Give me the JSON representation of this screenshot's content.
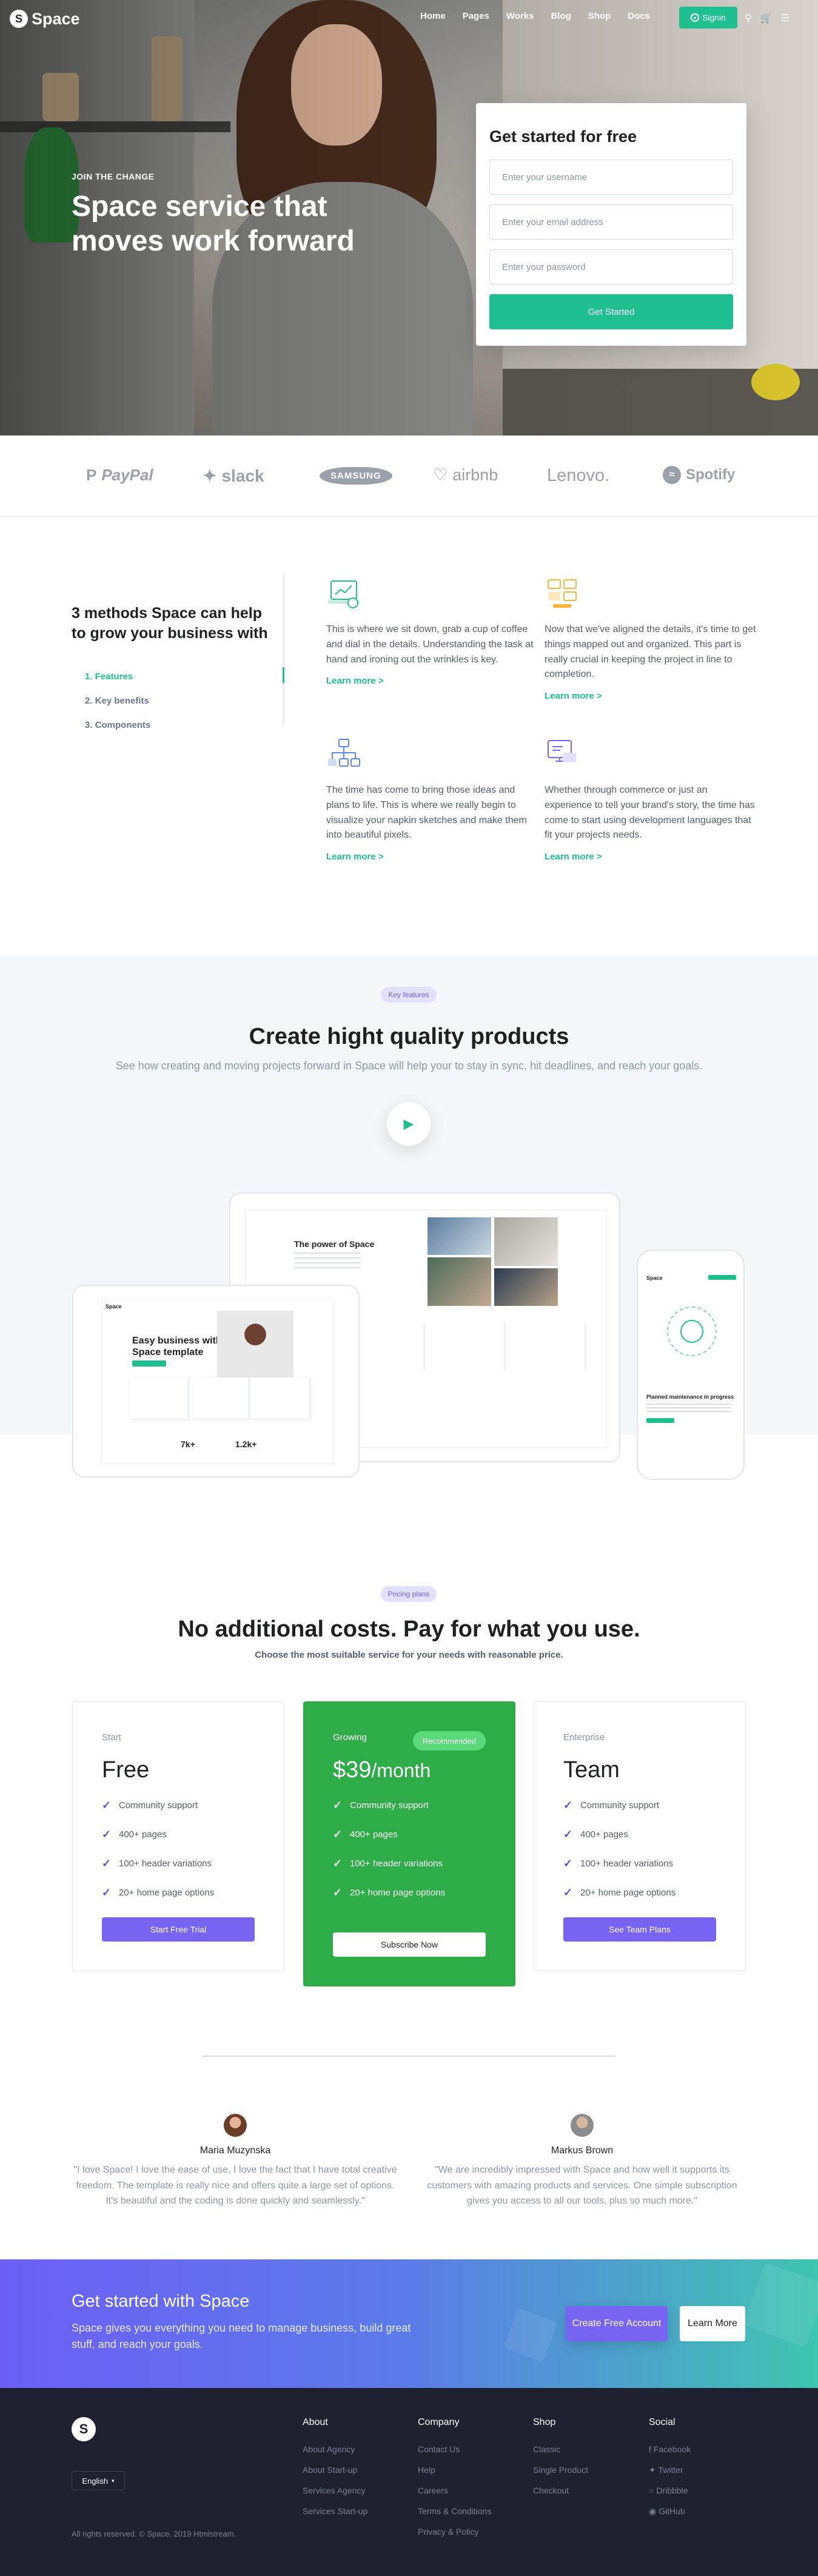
{
  "nav": {
    "brand": "Space",
    "brand_mark": "S",
    "items": [
      "Home",
      "Pages",
      "Works",
      "Blog",
      "Shop",
      "Docs"
    ],
    "signin": "Signin",
    "icons": [
      "search-icon",
      "cart-icon",
      "menu-icon"
    ]
  },
  "hero": {
    "eyebrow": "JOIN THE CHANGE",
    "title_line1": "Space service that",
    "title_line2": "moves work forward"
  },
  "signup": {
    "title": "Get started for free",
    "username_placeholder": "Enter your username",
    "email_placeholder": "Enter your email address",
    "password_placeholder": "Enter your password",
    "button": "Get Started"
  },
  "clients": [
    "PayPal",
    "slack",
    "SAMSUNG",
    "airbnb",
    "Lenovo.",
    "Spotify"
  ],
  "features": {
    "heading": "3 methods Space can help to grow your business with",
    "list": [
      "1. Features",
      "2. Key benefits",
      "3. Components"
    ],
    "cards": [
      {
        "icon": "laptop-chart-icon",
        "text": "This is where we sit down, grab a cup of coffee and dial in the details. Understanding the task at hand and ironing out the wrinkles is key.",
        "link": "Learn more >"
      },
      {
        "icon": "ui-blocks-icon",
        "text": "Now that we've aligned the details, it's time to get things mapped out and organized. This part is really crucial in keeping the project in line to completion.",
        "link": "Learn more >"
      },
      {
        "icon": "sitemap-icon",
        "text": "The time has come to bring those ideas and plans to life. This is where we really begin to visualize your napkin sketches and make them into beautiful pixels.",
        "link": "Learn more >"
      },
      {
        "icon": "monitor-chat-icon",
        "text": "Whether through commerce or just an experience to tell your brand's story, the time has come to start using development languages that fit your projects needs.",
        "link": "Learn more >"
      }
    ]
  },
  "key_features": {
    "pill": "Key features",
    "title": "Create hight quality products",
    "subtitle": "See how creating and moving projects forward in Space will help your to stay in sync, hit deadlines, and reach your goals.",
    "mockup": {
      "desktop_title": "The power of Space",
      "tablet_brand": "Space",
      "tablet_heading_1": "Easy business with",
      "tablet_heading_2": "Space template",
      "tablet_stat_1": "7k+",
      "tablet_stat_2": "1.2k+",
      "phone_brand": "Space",
      "phone_caption": "Planned maintenance in progress"
    }
  },
  "pricing": {
    "pill": "Pricing plans",
    "title": "No additional costs. Pay for what you use.",
    "subtitle": "Choose the most suitable service for your needs with reasonable price.",
    "plans": [
      {
        "label": "Start",
        "name": "Free",
        "features": [
          "Community support",
          "400+ pages",
          "100+ header variations",
          "20+ home page options"
        ],
        "button": "Start Free Trial"
      },
      {
        "label": "Growing",
        "badge": "Recommended",
        "price": "$39",
        "period": "/month",
        "features": [
          "Community support",
          "400+ pages",
          "100+ header variations",
          "20+ home page options"
        ],
        "button": "Subscribe Now"
      },
      {
        "label": "Enterprise",
        "name": "Team",
        "features": [
          "Community support",
          "400+ pages",
          "100+ header variations",
          "20+ home page options"
        ],
        "button": "See Team Plans"
      }
    ]
  },
  "testimonials": [
    {
      "name": "Maria Muzynska",
      "quote": "\"I love Space! I love the ease of use, I love the fact that I have total creative freedom. The template is really nice and offers quite a large set of options. It's beautiful and the coding is done quickly and seamlessly.\""
    },
    {
      "name": "Markus Brown",
      "quote": "\"We are incredibly impressed with Space and how well it supports its customers with amazing products and services. One simple subscription gives you access to all our tools, plus so much more.\""
    }
  ],
  "cta": {
    "title": "Get started with Space",
    "text": "Space gives you everything you need to manage business, build great stuff, and reach your goals.",
    "primary": "Create Free Account",
    "secondary": "Learn More"
  },
  "footer": {
    "brand_mark": "S",
    "language": "English",
    "copyright": "All rights reserved. © Space. 2019 Htmlstream.",
    "columns": [
      {
        "title": "About",
        "links": [
          "About Agency",
          "About Start-up",
          "Services Agency",
          "Services Start-up"
        ]
      },
      {
        "title": "Company",
        "links": [
          "Contact Us",
          "Help",
          "Careers",
          "Terms & Conditions",
          "Privacy & Policy"
        ]
      },
      {
        "title": "Shop",
        "links": [
          "Classic",
          "Single Product",
          "Checkout"
        ]
      },
      {
        "title": "Social",
        "links": [
          "Facebook",
          "Twitter",
          "Dribbble",
          "GitHub"
        ]
      }
    ]
  },
  "colors": {
    "accent": "#1fbf8f",
    "purple": "#7764f2",
    "pricing_green": "#2dac48",
    "footer_bg": "#1f2030"
  }
}
